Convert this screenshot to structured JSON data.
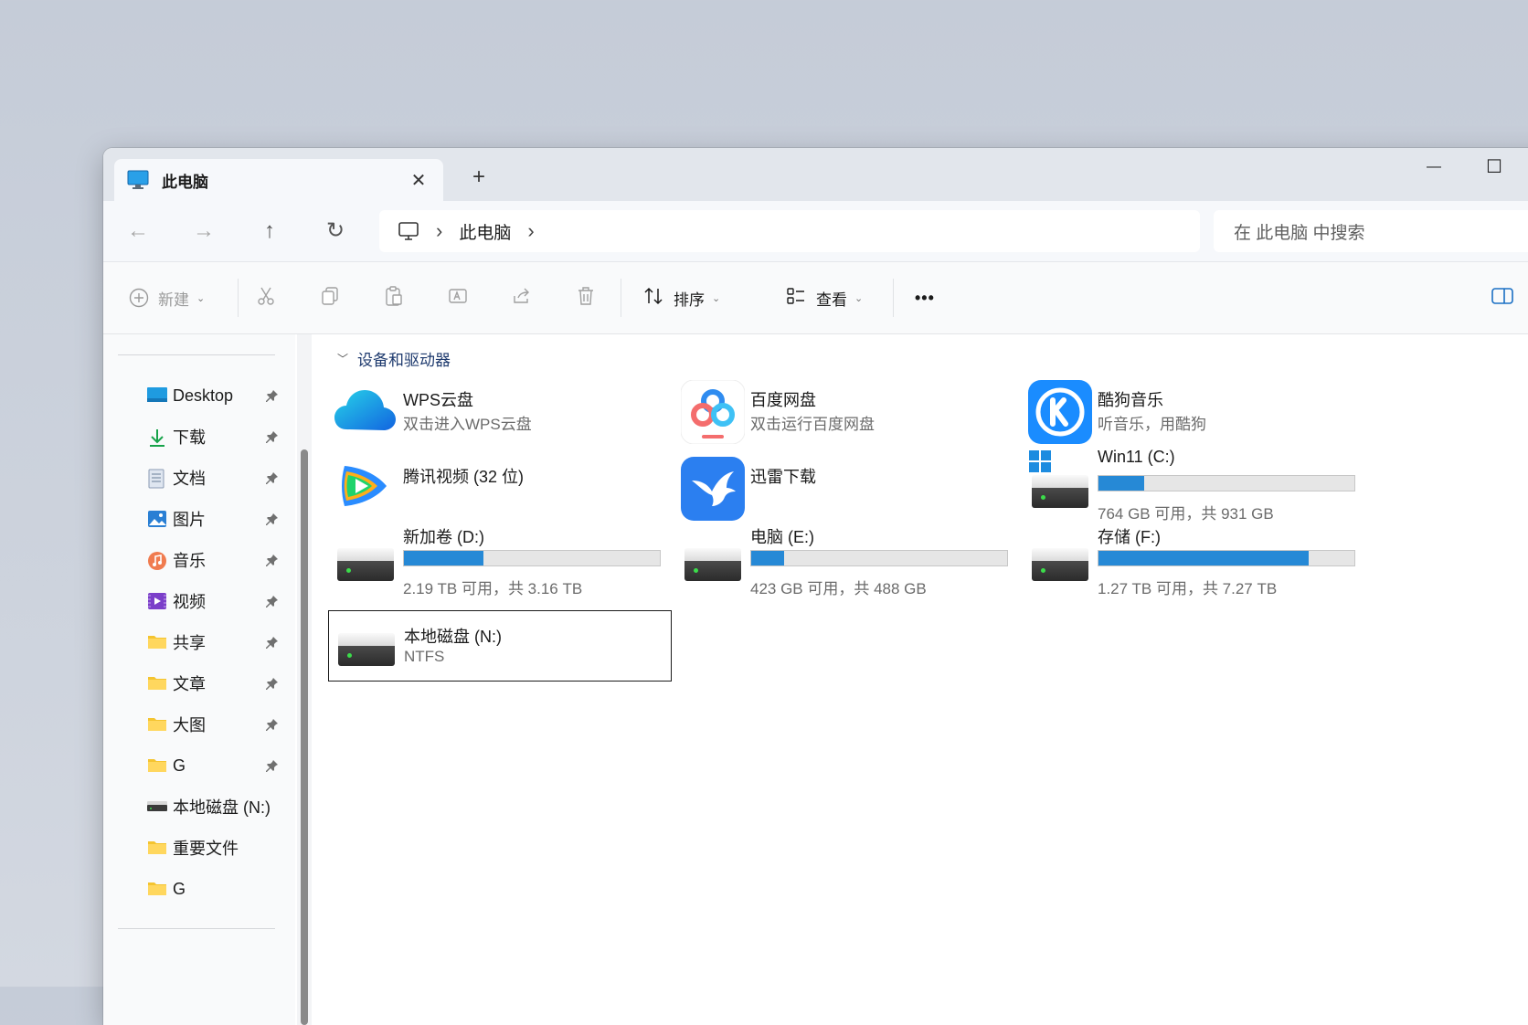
{
  "window": {
    "tab_title": "此电脑",
    "new_tab_symbol": "+",
    "close_symbol": "✕",
    "minimize_symbol": "—",
    "maximize_symbol": "☐"
  },
  "navigation": {
    "back": "←",
    "forward": "→",
    "up": "↑",
    "refresh": "↻",
    "breadcrumb": [
      "此电脑"
    ],
    "breadcrumb_separator": "›",
    "search_placeholder": "在 此电脑 中搜索"
  },
  "commands": {
    "new_label": "新建",
    "sort_label": "排序",
    "view_label": "查看",
    "more_label": "•••"
  },
  "sidebar": {
    "items": [
      {
        "label": "Desktop",
        "icon": "desktop-icon",
        "pinned": true
      },
      {
        "label": "下载",
        "icon": "download-icon",
        "pinned": true
      },
      {
        "label": "文档",
        "icon": "documents-icon",
        "pinned": true
      },
      {
        "label": "图片",
        "icon": "pictures-icon",
        "pinned": true
      },
      {
        "label": "音乐",
        "icon": "music-icon",
        "pinned": true
      },
      {
        "label": "视频",
        "icon": "videos-icon",
        "pinned": true
      },
      {
        "label": "共享",
        "icon": "folder-icon",
        "pinned": true
      },
      {
        "label": "文章",
        "icon": "folder-icon",
        "pinned": true
      },
      {
        "label": "大图",
        "icon": "folder-icon",
        "pinned": true
      },
      {
        "label": "G",
        "icon": "folder-icon",
        "pinned": true
      },
      {
        "label": "本地磁盘 (N:)",
        "icon": "drive-icon",
        "pinned": false
      },
      {
        "label": "重要文件",
        "icon": "folder-icon",
        "pinned": false
      },
      {
        "label": "G",
        "icon": "folder-icon",
        "pinned": false
      }
    ]
  },
  "content": {
    "section_title": "设备和驱动器",
    "apps": [
      {
        "name": "WPS云盘",
        "sub": "双击进入WPS云盘",
        "icon": "wps-cloud-icon"
      },
      {
        "name": "百度网盘",
        "sub": "双击运行百度网盘",
        "icon": "baidu-netdisk-icon"
      },
      {
        "name": "酷狗音乐",
        "sub": "听音乐，用酷狗",
        "icon": "kugou-music-icon"
      },
      {
        "name": "腾讯视频 (32 位)",
        "sub": "",
        "icon": "tencent-video-icon"
      },
      {
        "name": "迅雷下载",
        "sub": "",
        "icon": "xunlei-icon"
      }
    ],
    "drives": [
      {
        "name": "Win11 (C:)",
        "free_text": "764 GB 可用，共 931 GB",
        "used_fraction": 0.18,
        "icon": "windows-drive-icon"
      },
      {
        "name": "新加卷 (D:)",
        "free_text": "2.19 TB 可用，共 3.16 TB",
        "used_fraction": 0.31,
        "icon": "drive-icon"
      },
      {
        "name": "电脑 (E:)",
        "free_text": "423 GB 可用，共 488 GB",
        "used_fraction": 0.13,
        "icon": "drive-icon"
      },
      {
        "name": "存储 (F:)",
        "free_text": "1.27 TB 可用，共 7.27 TB",
        "used_fraction": 0.82,
        "icon": "drive-icon"
      },
      {
        "name": "本地磁盘 (N:)",
        "free_text": "NTFS",
        "icon": "drive-icon"
      }
    ]
  },
  "colors": {
    "accent": "#2689d6",
    "kugou_blue": "#1a8cff",
    "xunlei_blue": "#2b7ff0"
  }
}
